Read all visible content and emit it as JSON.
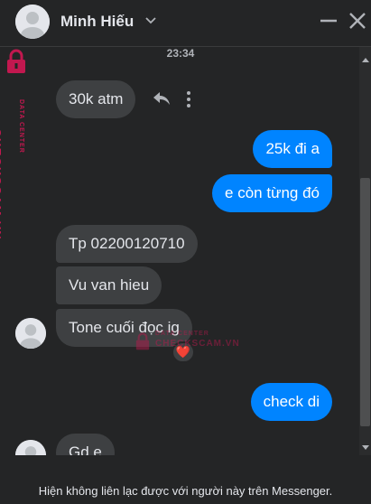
{
  "header": {
    "name": "Minh Hiếu",
    "icons": [
      "avatar",
      "chevron-down-icon",
      "minimize-icon",
      "close-icon"
    ]
  },
  "messages": {
    "timestamp": "23:34",
    "items": [
      {
        "direction": "in",
        "text": "30k atm"
      },
      {
        "direction": "out",
        "text": "25k đi a"
      },
      {
        "direction": "out",
        "text": "e còn từng đó"
      },
      {
        "direction": "in",
        "text": "Tp 02200120710"
      },
      {
        "direction": "in",
        "text": "Vu van hieu"
      },
      {
        "direction": "in",
        "text": "Tone cuối đọc ig",
        "reaction": "❤️"
      },
      {
        "direction": "out",
        "text": "check di"
      },
      {
        "direction": "in",
        "text": "Gd e"
      }
    ]
  },
  "watermark": {
    "brand": "CHECKSCAM.VN",
    "small": "DATA CENTER"
  },
  "footer": {
    "notice": "Hiện không liên lạc được với người này trên Messenger."
  },
  "colors": {
    "background": "#242526",
    "incoming_bubble": "#3e4042",
    "outgoing_bubble": "#0084ff",
    "watermark": "#c2184f"
  }
}
